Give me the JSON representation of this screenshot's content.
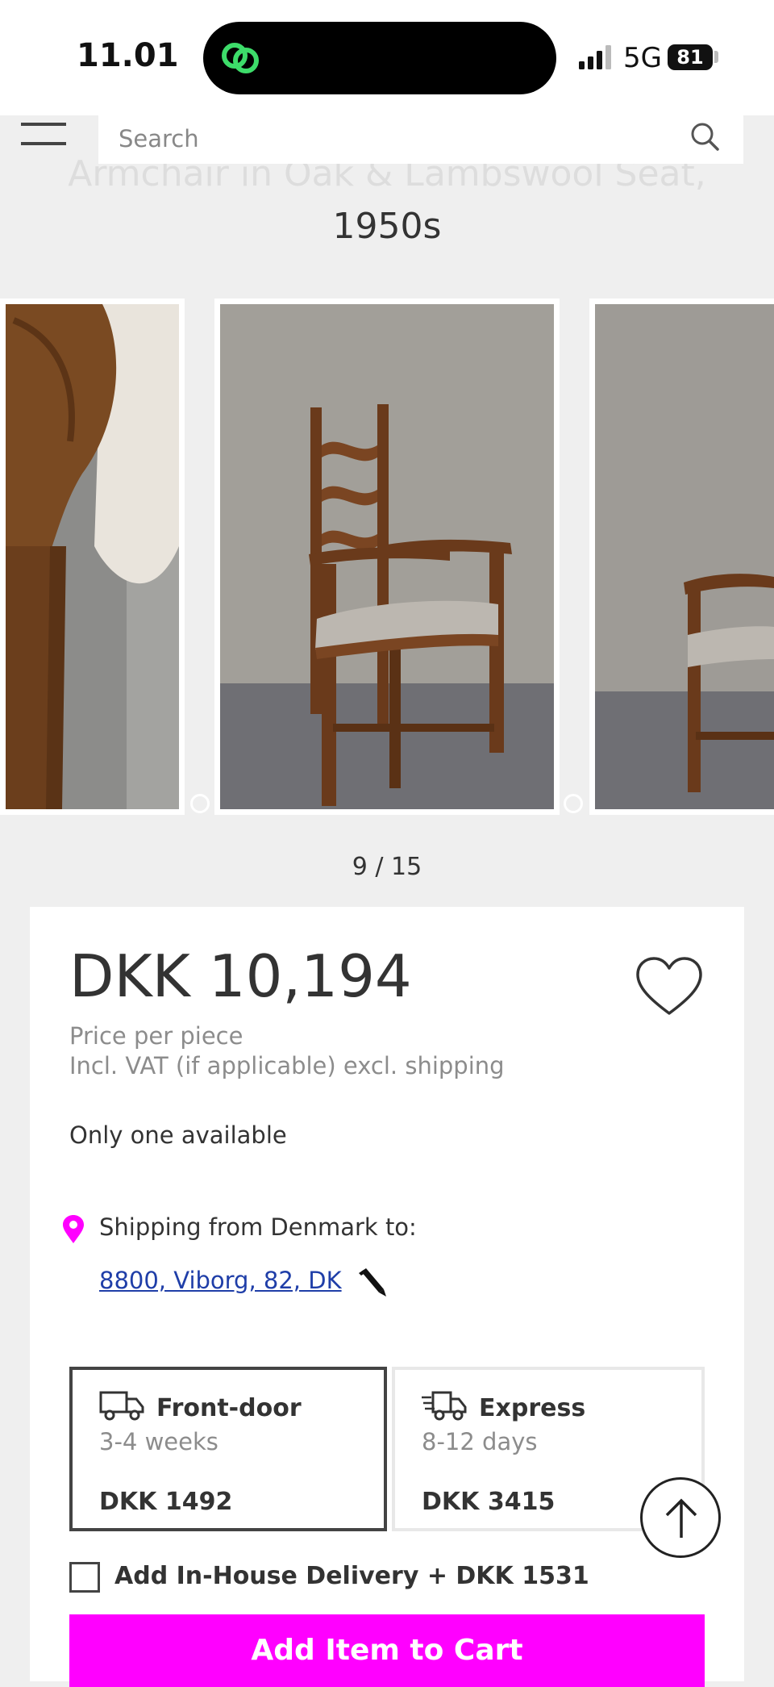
{
  "status_bar": {
    "time": "11.01",
    "network": "5G",
    "battery": "81"
  },
  "search": {
    "placeholder": "Search"
  },
  "product": {
    "title_partial": "Armchair in Oak & Lambswool Seat,",
    "title_year": "1950s",
    "gallery_counter": "9 / 15",
    "price": "DKK 10,194",
    "price_per": "Price per piece",
    "vat_note": "Incl. VAT (if applicable) excl. shipping",
    "availability": "Only one available"
  },
  "shipping": {
    "from_label": "Shipping from Denmark to:",
    "destination": "8800, Viborg, 82, DK",
    "options": [
      {
        "name": "Front-door",
        "duration": "3-4 weeks",
        "price": "DKK 1492",
        "selected": true
      },
      {
        "name": "Express",
        "duration": "8-12 days",
        "price": "DKK 3415",
        "selected": false
      }
    ],
    "inhouse_label": "Add In-House Delivery + DKK 1531",
    "inhouse_checked": false
  },
  "actions": {
    "add_to_cart": "Add Item to Cart"
  },
  "colors": {
    "accent": "#ff00ff",
    "pin": "#ff00ff",
    "app_icon": "#3ddc6a"
  },
  "icons": [
    "app-link-icon",
    "signal-icon",
    "battery-icon",
    "menu-icon",
    "search-icon",
    "heart-icon",
    "location-pin-icon",
    "pencil-icon",
    "truck-icon",
    "express-truck-icon",
    "arrow-up-icon"
  ]
}
